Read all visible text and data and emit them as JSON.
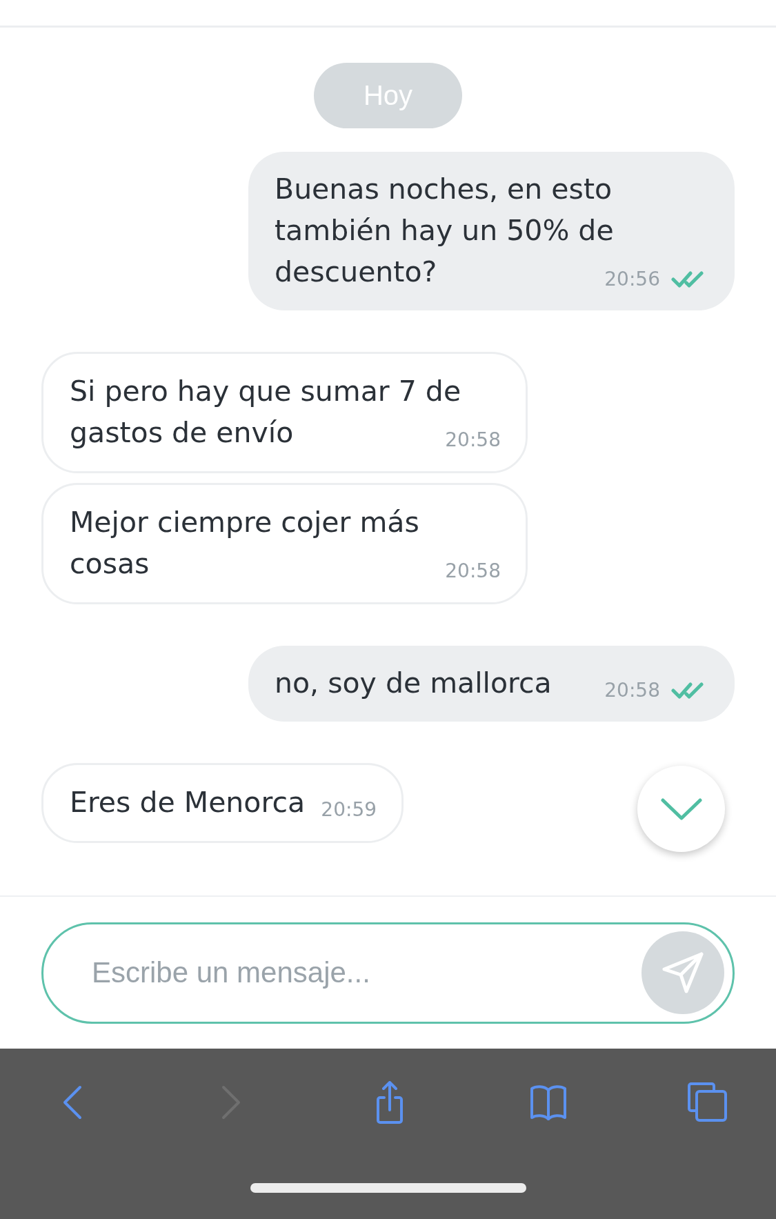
{
  "date_separator": "Hoy",
  "messages": [
    {
      "kind": "outgoing",
      "text": "Buenas noches, en esto también hay un 50% de descuento?",
      "time": "20:56",
      "read": true
    },
    {
      "kind": "incoming",
      "text": "Si pero hay que sumar 7 de gastos de envío",
      "time": "20:58"
    },
    {
      "kind": "incoming",
      "text": "Mejor ciempre cojer más cosas",
      "time": "20:58"
    },
    {
      "kind": "outgoing",
      "text": "no, soy de mallorca",
      "time": "20:58",
      "read": true
    },
    {
      "kind": "incoming",
      "text": "Eres de Menorca",
      "time": "20:59"
    }
  ],
  "composer": {
    "placeholder": "Escribe un mensaje..."
  },
  "toolbar": [
    {
      "kind": "back",
      "disabled": false
    },
    {
      "kind": "forward",
      "disabled": true
    },
    {
      "kind": "share",
      "disabled": false
    },
    {
      "kind": "bookmarks",
      "disabled": false
    },
    {
      "kind": "tabs",
      "disabled": false
    }
  ]
}
